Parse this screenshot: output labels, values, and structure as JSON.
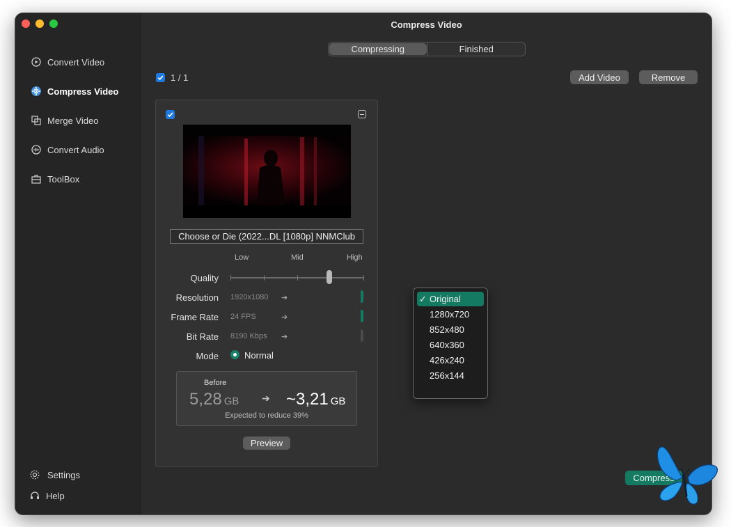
{
  "window": {
    "title": "Compress Video"
  },
  "sidebar": {
    "items": [
      {
        "label": "Convert Video",
        "icon": "convert-video-icon"
      },
      {
        "label": "Compress Video",
        "icon": "compress-video-icon",
        "active": true
      },
      {
        "label": "Merge Video",
        "icon": "merge-video-icon"
      },
      {
        "label": "Convert Audio",
        "icon": "convert-audio-icon"
      },
      {
        "label": "ToolBox",
        "icon": "toolbox-icon"
      }
    ],
    "bottom": [
      {
        "label": "Settings",
        "icon": "gear-icon"
      },
      {
        "label": "Help",
        "icon": "headset-icon"
      }
    ]
  },
  "tabs": {
    "compressing": "Compressing",
    "finished": "Finished",
    "selected": "Compressing"
  },
  "toolbar": {
    "count": "1 / 1",
    "add_video": "Add Video",
    "remove": "Remove"
  },
  "card": {
    "filename": "Choose or Die (2022...DL [1080p] NNMClub",
    "quality": {
      "label": "Quality",
      "low": "Low",
      "mid": "Mid",
      "high": "High",
      "level_fraction": 0.74
    },
    "resolution": {
      "label": "Resolution",
      "value": "1920x1080"
    },
    "frame_rate": {
      "label": "Frame Rate",
      "value": "24 FPS"
    },
    "bit_rate": {
      "label": "Bit Rate",
      "value": "8190 Kbps"
    },
    "mode": {
      "label": "Mode",
      "value": "Normal"
    },
    "size": {
      "before_label": "Before",
      "before_value": "5,28",
      "before_unit": "GB",
      "after_value": "~3,21",
      "after_unit": "GB",
      "reduce_text": "Expected to reduce 39%"
    },
    "preview": "Preview"
  },
  "resolution_menu": {
    "options": [
      "Original",
      "1280x720",
      "852x480",
      "640x360",
      "426x240",
      "256x144"
    ],
    "selected": "Original",
    "check": "✓"
  },
  "compress_button": "Compress",
  "colors": {
    "accent_green": "#147a61",
    "checkbox_blue": "#1f7ae0",
    "sidebar": "#252525",
    "main": "#2b2b2b"
  }
}
